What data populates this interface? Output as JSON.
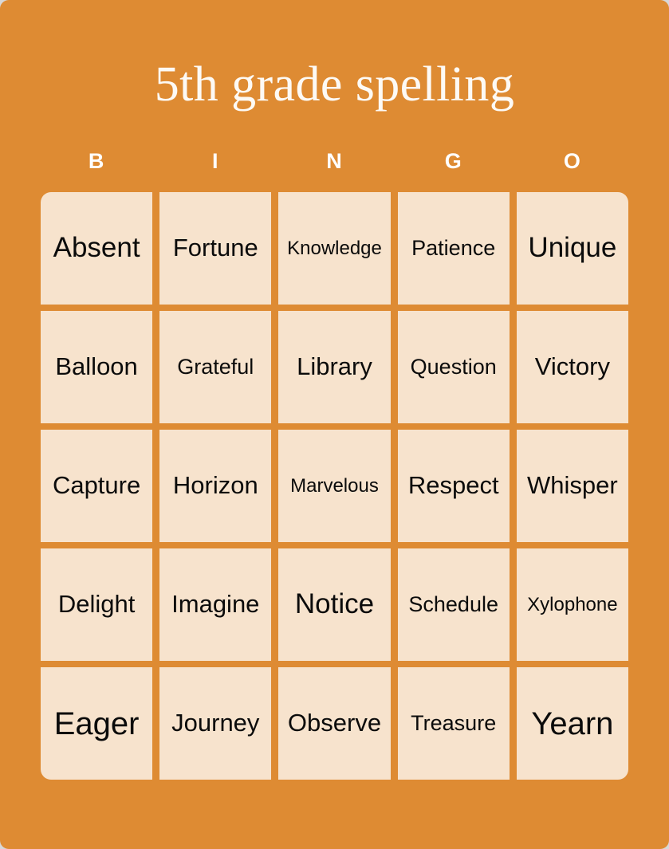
{
  "card": {
    "title": "5th grade spelling",
    "background_color": "#de8b33",
    "cell_color": "#f7e3cd",
    "title_color": "#fdfaf5",
    "cell_text_color": "#0b0b0b"
  },
  "header": {
    "letters": [
      "B",
      "I",
      "N",
      "G",
      "O"
    ]
  },
  "grid": {
    "rows": 5,
    "columns": 5,
    "cells": [
      [
        "Absent",
        "Fortune",
        "Knowledge",
        "Patience",
        "Unique"
      ],
      [
        "Balloon",
        "Grateful",
        "Library",
        "Question",
        "Victory"
      ],
      [
        "Capture",
        "Horizon",
        "Marvelous",
        "Respect",
        "Whisper"
      ],
      [
        "Delight",
        "Imagine",
        "Notice",
        "Schedule",
        "Xylophone"
      ],
      [
        "Eager",
        "Journey",
        "Observe",
        "Treasure",
        "Yearn"
      ]
    ]
  }
}
